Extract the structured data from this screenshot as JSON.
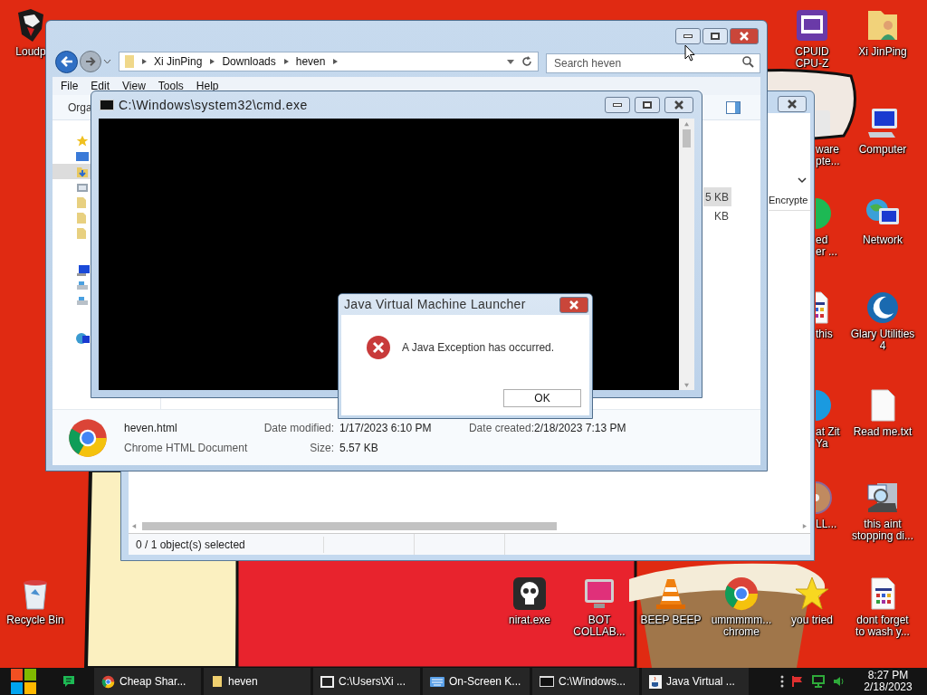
{
  "desktop": {
    "icons": [
      {
        "kind": "lion",
        "lines": [
          "Loudp"
        ]
      },
      {
        "kind": "cpu",
        "lines": [
          "CPUID",
          "CPU-Z"
        ]
      },
      {
        "kind": "folder-user",
        "lines": [
          "Xi JinPing"
        ]
      },
      {
        "kind": "partial",
        "lines": [
          "ware",
          "pte..."
        ]
      },
      {
        "kind": "computer",
        "lines": [
          "Computer"
        ]
      },
      {
        "kind": "green",
        "lines": [
          "ed",
          "er ..."
        ]
      },
      {
        "kind": "network",
        "lines": [
          "Network"
        ]
      },
      {
        "kind": "doc-grid",
        "lines": [
          "this"
        ]
      },
      {
        "kind": "glary",
        "lines": [
          "Glary Utilities",
          "4"
        ]
      },
      {
        "kind": "skype",
        "lines": [
          "at Zit",
          "Ya"
        ]
      },
      {
        "kind": "text",
        "lines": [
          "Read me.txt"
        ]
      },
      {
        "kind": "disc",
        "lines": [
          "LL..."
        ]
      },
      {
        "kind": "search-pc",
        "lines": [
          "this aint",
          "stopping di..."
        ]
      },
      {
        "kind": "recycle",
        "lines": [
          "Recycle Bin"
        ]
      },
      {
        "kind": "skull",
        "lines": [
          "nirat.exe"
        ]
      },
      {
        "kind": "monitor",
        "lines": [
          "BOT",
          "COLLAB..."
        ]
      },
      {
        "kind": "cone",
        "lines": [
          "BEEP BEEP"
        ]
      },
      {
        "kind": "chrome",
        "lines": [
          "ummmmm...",
          "chrome"
        ]
      },
      {
        "kind": "star",
        "lines": [
          "you tried"
        ]
      },
      {
        "kind": "doc-grid",
        "lines": [
          "dont forget",
          "to wash y..."
        ]
      }
    ]
  },
  "explorer_back": {
    "column_header": "Encrypte",
    "status_bar": "0 / 1 object(s) selected"
  },
  "explorer": {
    "breadcrumb": [
      "Xi JinPing",
      "Downloads",
      "heven"
    ],
    "search": {
      "placeholder": "Search heven"
    },
    "menu": [
      "File",
      "Edit",
      "View",
      "Tools",
      "Help"
    ],
    "toolbar": "Orga",
    "nav_pane": [
      {
        "items": [
          {
            "kind": "star",
            "selected": false
          },
          {
            "kind": "desktop",
            "selected": false
          },
          {
            "kind": "downloads",
            "selected": true
          },
          {
            "kind": "places",
            "selected": false
          },
          {
            "kind": "folder",
            "selected": false
          },
          {
            "kind": "folder",
            "selected": false
          },
          {
            "kind": "folder",
            "selected": false
          }
        ]
      },
      {
        "items": [
          {
            "kind": "computer",
            "selected": false
          },
          {
            "kind": "drive",
            "selected": false
          },
          {
            "kind": "drive",
            "selected": false
          }
        ]
      },
      {
        "items": [
          {
            "kind": "network",
            "selected": false
          }
        ]
      }
    ],
    "files": [
      {
        "size": "5 KB",
        "selected": true
      },
      {
        "size": "KB",
        "selected": false
      }
    ],
    "details": {
      "name": "heven.html",
      "type": "Chrome HTML Document",
      "fields": [
        {
          "label": "Date modified:",
          "value": "1/17/2023 6:10 PM"
        },
        {
          "label": "Size:",
          "value": "5.57 KB"
        },
        {
          "label": "Date created:",
          "value": "2/18/2023 7:13 PM"
        }
      ]
    }
  },
  "cmd": {
    "title": "C:\\Windows\\system32\\cmd.exe"
  },
  "dialog": {
    "title": "Java Virtual Machine Launcher",
    "message": "A Java Exception has occurred.",
    "button": "OK"
  },
  "taskbar": {
    "tasks": [
      {
        "kind": "chrome",
        "label": "Cheap Shar..."
      },
      {
        "kind": "folder",
        "label": "heven"
      },
      {
        "kind": "archive",
        "label": "C:\\Users\\Xi ..."
      },
      {
        "kind": "keyboard",
        "label": "On-Screen K..."
      },
      {
        "kind": "cmd",
        "label": "C:\\Windows..."
      },
      {
        "kind": "java",
        "label": "Java Virtual ..."
      }
    ],
    "clock": {
      "time": "8:27 PM",
      "date": "2/18/2023"
    }
  }
}
